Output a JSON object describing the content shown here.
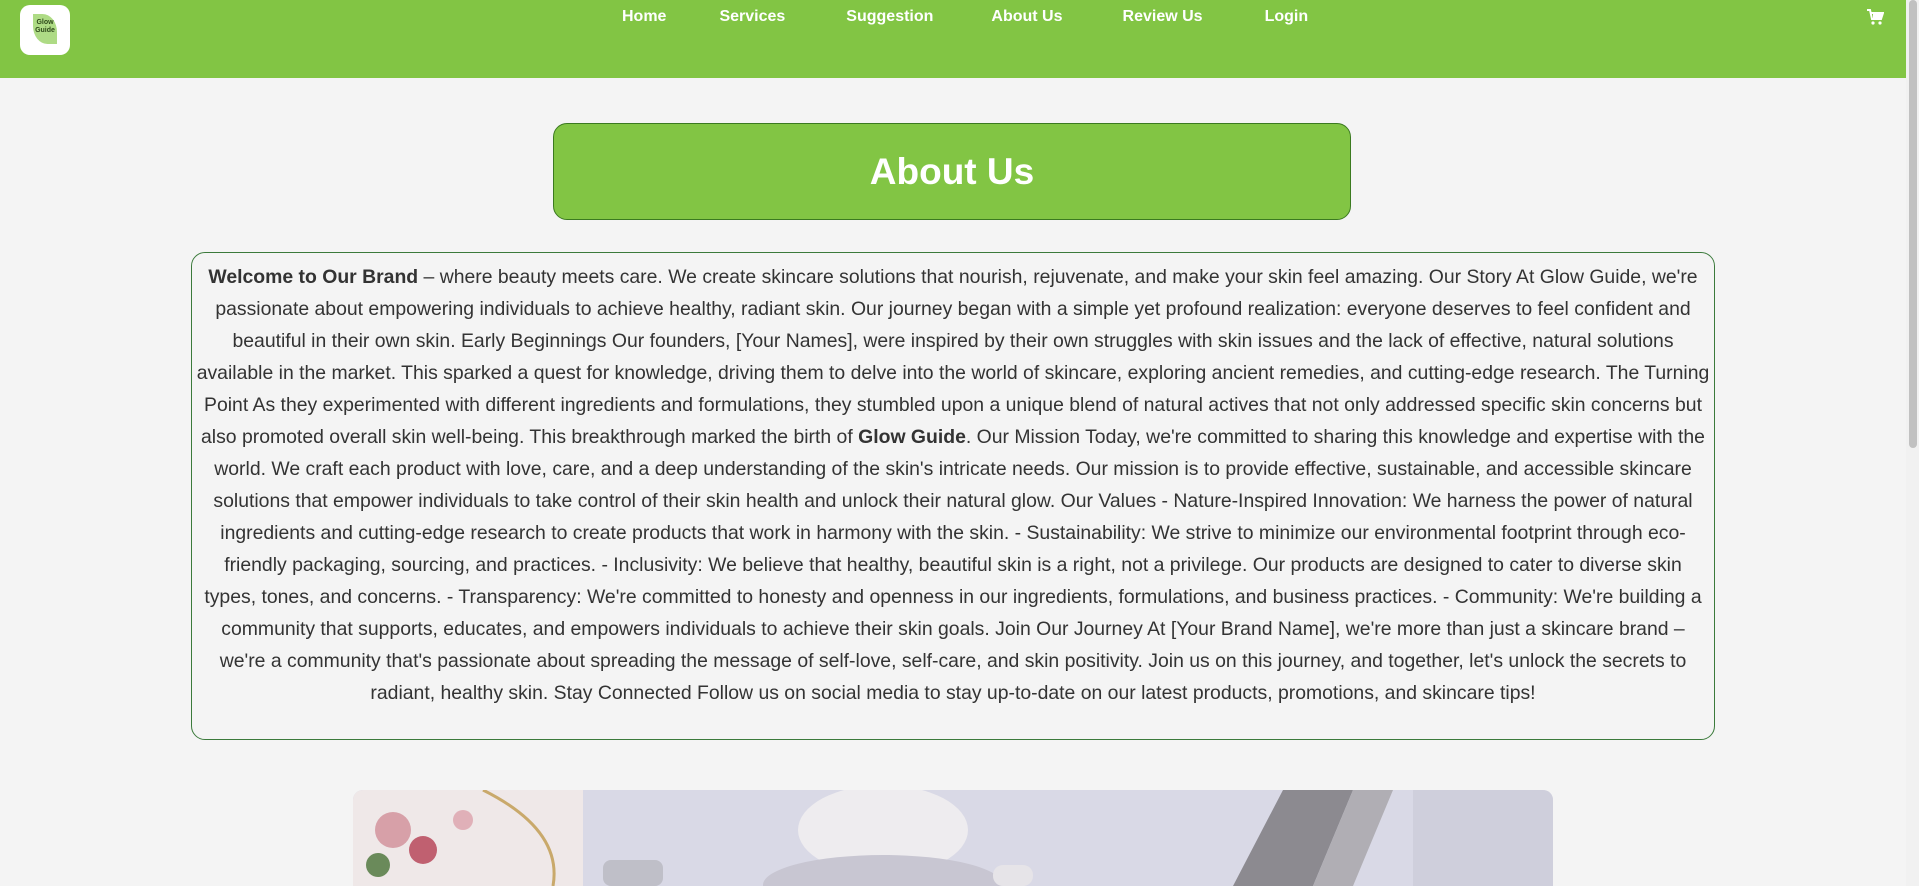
{
  "brand": {
    "logo_text": "Glow Guide"
  },
  "nav": {
    "items": [
      {
        "label": "Home"
      },
      {
        "label": "Services"
      },
      {
        "label": "Suggestion"
      },
      {
        "label": "About Us"
      },
      {
        "label": "Review Us"
      },
      {
        "label": "Login"
      }
    ],
    "cart_icon": "shopping-cart-icon"
  },
  "about": {
    "title": "About Us",
    "intro_bold": "Welcome to Our Brand",
    "text_part1": " – where beauty meets care. We create skincare solutions that nourish, rejuvenate, and make your skin feel amazing. Our Story At Glow Guide, we're passionate about empowering individuals to achieve healthy, radiant skin. Our journey began with a simple yet profound realization: everyone deserves to feel confident and beautiful in their own skin. Early Beginnings Our founders, [Your Names], were inspired by their own struggles with skin issues and the lack of effective, natural solutions available in the market. This sparked a quest for knowledge, driving them to delve into the world of skincare, exploring ancient remedies, and cutting-edge research. The Turning Point As they experimented with different ingredients and formulations, they stumbled upon a unique blend of natural actives that not only addressed specific skin concerns but also promoted overall skin well-being. This breakthrough marked the birth of ",
    "brand_bold": "Glow Guide",
    "text_part2": ". Our Mission Today, we're committed to sharing this knowledge and expertise with the world. We craft each product with love, care, and a deep understanding of the skin's intricate needs. Our mission is to provide effective, sustainable, and accessible skincare solutions that empower individuals to take control of their skin health and unlock their natural glow. Our Values - Nature-Inspired Innovation: We harness the power of natural ingredients and cutting-edge research to create products that work in harmony with the skin. - Sustainability: We strive to minimize our environmental footprint through eco-friendly packaging, sourcing, and practices. - Inclusivity: We believe that healthy, beautiful skin is a right, not a privilege. Our products are designed to cater to diverse skin types, tones, and concerns. - Transparency: We're committed to honesty and openness in our ingredients, formulations, and business practices. - Community: We're building a community that supports, educates, and empowers individuals to achieve their skin goals. Join Our Journey At [Your Brand Name], we're more than just a skincare brand – we're a community that's passionate about spreading the message of self-love, self-care, and skin positivity. Join us on this journey, and together, let's unlock the secrets to radiant, healthy skin. Stay Connected Follow us on social media to stay up-to-date on our latest products, promotions, and skincare tips!"
  },
  "colors": {
    "brand_green": "#82c544",
    "border_green": "#3b7a3b",
    "page_bg": "#f4f4f4"
  }
}
